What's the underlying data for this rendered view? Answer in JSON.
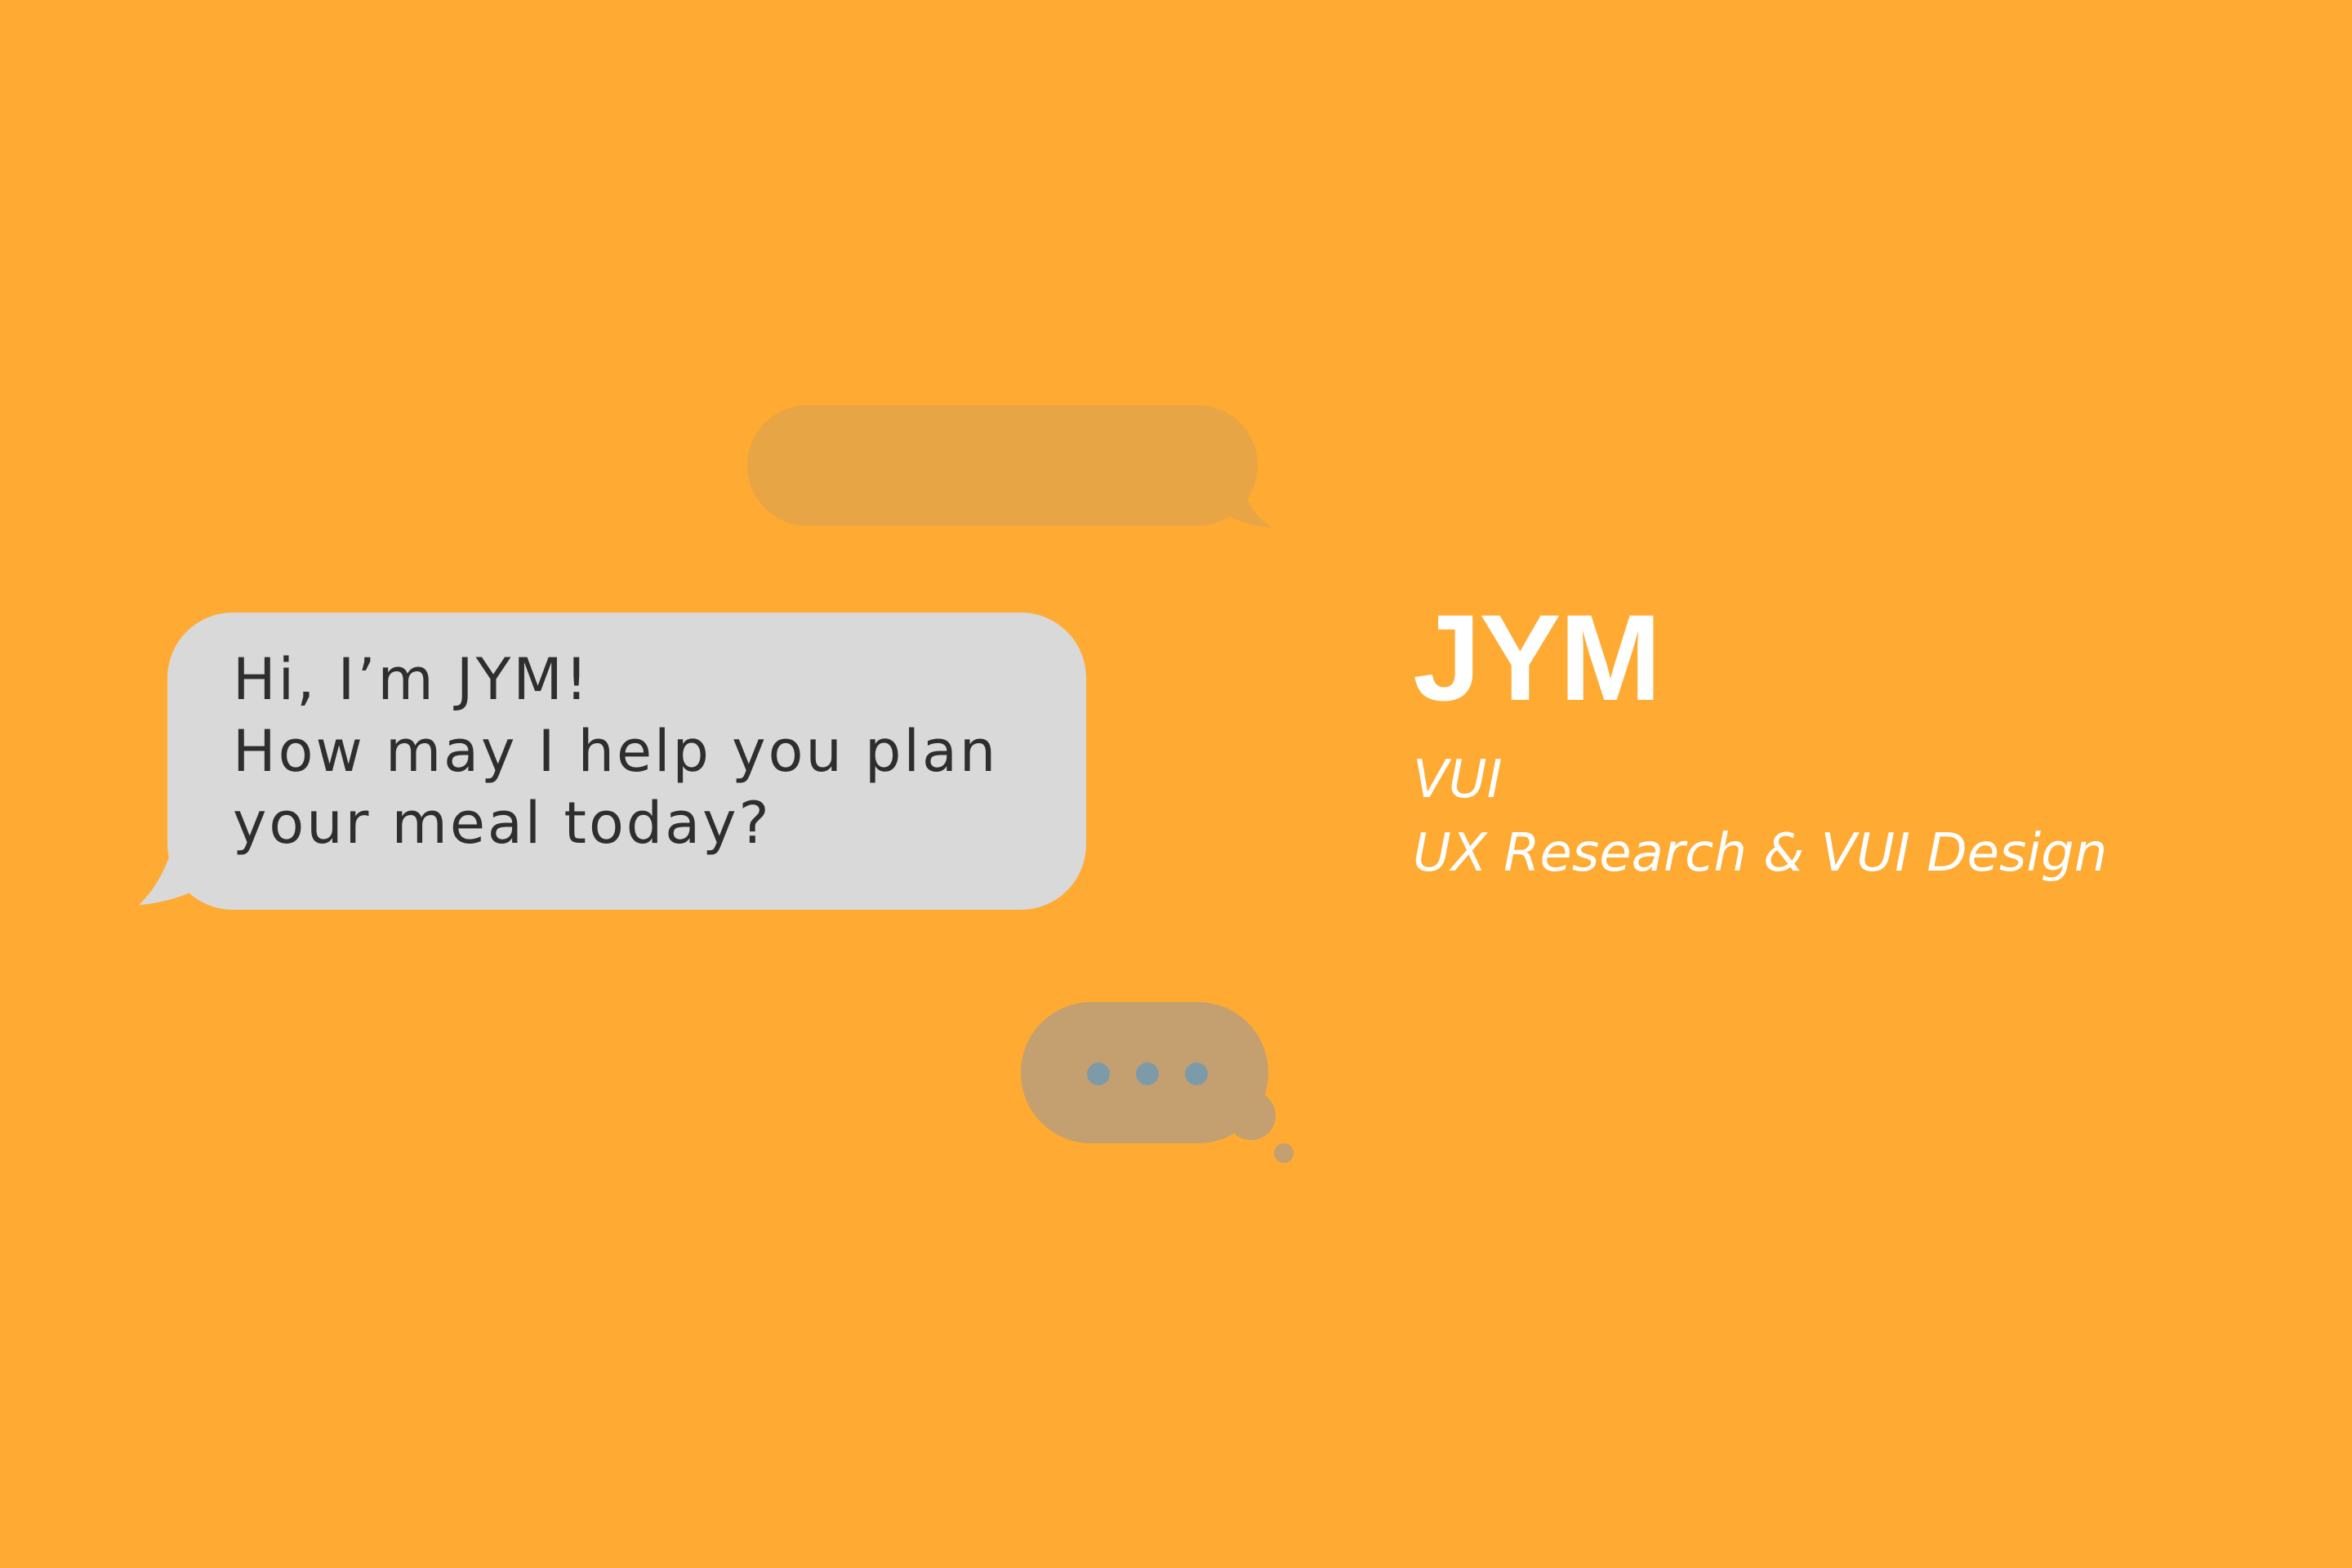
{
  "colors": {
    "background": "#FFAA33",
    "faded_bubble": "#E8A545",
    "bot_bubble": "#D9D9D9",
    "bot_text": "#2E2E2E",
    "thinking_bubble": "#C4A070",
    "thinking_dots": "#7D9AA8",
    "title_text": "#FFFFFF"
  },
  "chat": {
    "bot_message_lines": [
      "Hi, I’m JYM!",
      "How may I help you plan",
      "your meal today?"
    ],
    "faded_user_bubble_icon": "speech-bubble-placeholder",
    "typing_indicator_icon": "thought-bubble-typing-dots"
  },
  "project": {
    "title": "JYM",
    "category": "VUI",
    "role": "UX Research & VUI Design"
  }
}
